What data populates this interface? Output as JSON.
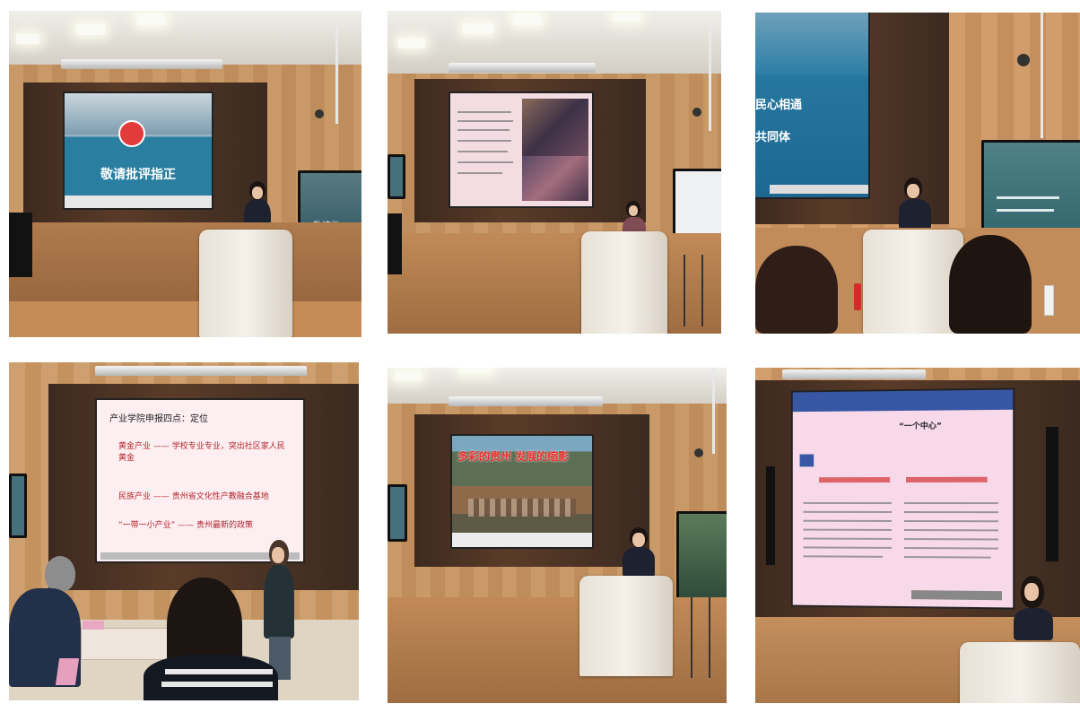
{
  "photos": [
    {
      "slide": {
        "title": "敬请批评指正"
      }
    },
    {
      "slide": {}
    },
    {
      "slide": {
        "line1": "民心相通",
        "line2": "共同体"
      }
    },
    {
      "slide": {
        "heading": "产业学院申报四点：定位",
        "item1": "黄金产业 —— 学校专业专业，突出社区家人民黄金",
        "item2": "民族产业 —— 贵州省文化性产教融合基地",
        "item3": "“一带一小产业” —— 贵州最新的政策"
      }
    },
    {
      "slide": {
        "title": "多彩的贵州 发展的缩影"
      }
    },
    {
      "slide": {
        "header": "“一个中心”"
      }
    }
  ]
}
